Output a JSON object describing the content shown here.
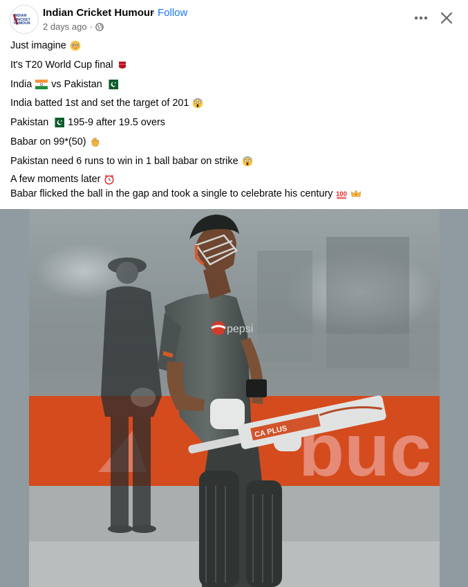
{
  "header": {
    "page_name": "Indian Cricket Humour",
    "separator": "·",
    "follow_label": "Follow",
    "timestamp": "2 days ago",
    "dot": "·",
    "avatar_text": "INDIAN CRICKET HUMOUR",
    "privacy_icon": "globe-icon",
    "more_icon": "more-options-icon",
    "close_icon": "close-icon"
  },
  "post": {
    "lines": [
      {
        "text": "Just imagine",
        "emoji": "flushed-face-emoji"
      },
      {
        "text": "It's T20 World Cup final",
        "emoji": "red-ball-emoji"
      },
      {
        "text_a": "India",
        "flag_a": "india-flag-icon",
        "text_b": "vs Pakistan",
        "flag_b": "pakistan-flag-icon"
      },
      {
        "text": "India batted 1st and set the target of 201",
        "emoji": "screaming-face-emoji"
      },
      {
        "text_a": "Pakistan",
        "flag": "pakistan-flag-icon",
        "text_b": "195-9 after 19.5 overs"
      },
      {
        "text": "Babar on 99*(50)",
        "emoji": "clapping-hands-emoji"
      },
      {
        "text": "Pakistan need 6 runs to win in 1 ball babar on strike",
        "emoji": "screaming-face-emoji"
      },
      {
        "text": "A few moments later",
        "emoji": "alarm-clock-emoji"
      },
      {
        "text": "Babar flicked the ball in the gap and took a single to celebrate his century",
        "emoji_a": "hundred-points-emoji",
        "emoji_b": "crown-emoji"
      }
    ]
  },
  "media": {
    "jersey_text": "pepsi",
    "banner_text": "buc",
    "bat_text": "CA PLUS"
  },
  "colors": {
    "link": "#1877f2",
    "secondary_text": "#65676b",
    "primary_text": "#050505",
    "media_bg": "#8f9aa1"
  }
}
